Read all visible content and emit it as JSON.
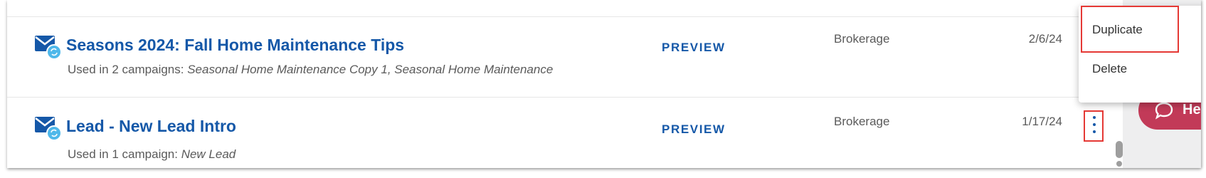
{
  "rows": [
    {
      "title": "Seasons 2024: Fall Home Maintenance Tips",
      "usage_prefix": "Used in 2 campaigns: ",
      "usage_campaigns": "Seasonal Home Maintenance Copy 1, Seasonal Home Maintenance",
      "preview_label": "PREVIEW",
      "owner": "Brokerage",
      "date": "2/6/24"
    },
    {
      "title": "Lead - New Lead Intro",
      "usage_prefix": "Used in 1 campaign: ",
      "usage_campaigns": "New Lead",
      "preview_label": "PREVIEW",
      "owner": "Brokerage",
      "date": "1/17/24"
    }
  ],
  "context_menu": {
    "items": [
      {
        "label": "Duplicate"
      },
      {
        "label": "Delete"
      }
    ]
  },
  "help_button": {
    "label": "Help"
  },
  "colors": {
    "accent_blue": "#1558a8",
    "icon_badge": "#4fb8ea",
    "highlight_red": "#e53935",
    "help_button": "#c23a58"
  },
  "icons": [
    "email-sync-icon",
    "more-vert-icon",
    "chat-bubble-icon"
  ]
}
